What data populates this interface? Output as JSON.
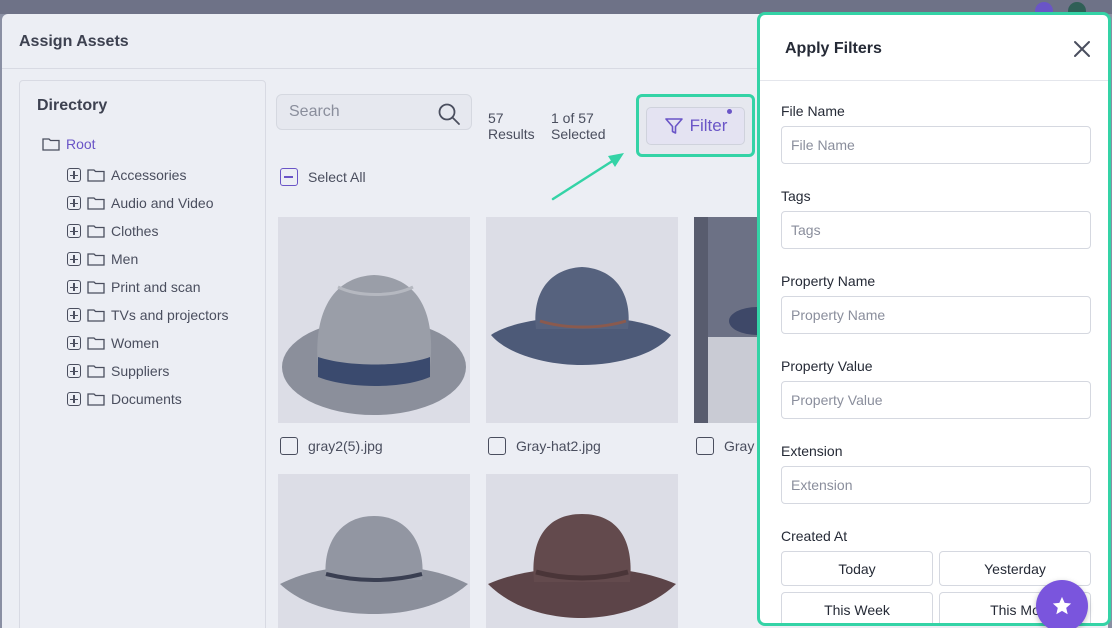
{
  "modal": {
    "title": "Assign Assets"
  },
  "directory": {
    "title": "Directory",
    "root": "Root",
    "items": [
      "Accessories",
      "Audio and Video",
      "Clothes",
      "Men",
      "Print and scan",
      "TVs and projectors",
      "Women",
      "Suppliers",
      "Documents"
    ]
  },
  "toolbar": {
    "search_placeholder": "Search",
    "results_count": "57",
    "results_label": "Results",
    "selected_count": "1 of 57",
    "selected_label": "Selected",
    "filter_label": "Filter",
    "select_all": "Select All"
  },
  "assets": [
    {
      "name": "gray2(5).jpg"
    },
    {
      "name": "Gray-hat2.jpg"
    },
    {
      "name": "Gray"
    }
  ],
  "filters": {
    "title": "Apply Filters",
    "file_name_label": "File Name",
    "file_name_placeholder": "File Name",
    "tags_label": "Tags",
    "tags_placeholder": "Tags",
    "property_name_label": "Property Name",
    "property_name_placeholder": "Property Name",
    "property_value_label": "Property Value",
    "property_value_placeholder": "Property Value",
    "extension_label": "Extension",
    "extension_placeholder": "Extension",
    "created_at_label": "Created At",
    "date_options": [
      "Today",
      "Yesterday",
      "This Week",
      "This Mo"
    ]
  },
  "colors": {
    "accent": "#6a55c7",
    "highlight": "#34d3a6",
    "fab": "#7a55dd"
  }
}
